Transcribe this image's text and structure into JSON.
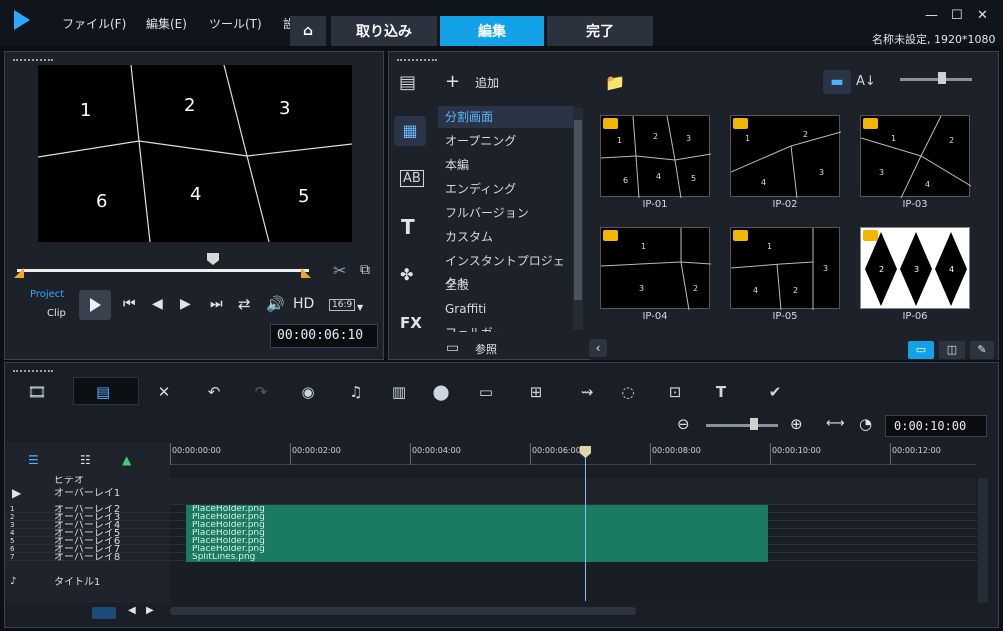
{
  "app": {
    "title": "名称未設定, 1920*1080"
  },
  "menu": [
    "ファイル(F)",
    "編集(E)",
    "ツール(T)",
    "設"
  ],
  "tabs": {
    "home": "⌂",
    "capture": "取り込み",
    "edit": "編集",
    "share": "完了"
  },
  "preview": {
    "split_numbers": [
      "1",
      "2",
      "3",
      "6",
      "4",
      "5"
    ],
    "mode_project": "Project",
    "mode_clip": "Clip",
    "hd": "HD",
    "aspect": "16:9",
    "timecode": "00:00:06:10"
  },
  "library": {
    "add_label": "追加",
    "browse_label": "参照",
    "categories": [
      "分割画面",
      "オープニング",
      "本編",
      "エンディング",
      "フルバージョン",
      "カスタム",
      "インスタントプロジェクト",
      "全般",
      "Graffiti",
      "フェルガー"
    ],
    "selected_category": 0,
    "thumbs": [
      "IP-01",
      "IP-02",
      "IP-03",
      "IP-04",
      "IP-05",
      "IP-06"
    ]
  },
  "timeline": {
    "zoom_timecode": "0:00:10:00",
    "ruler": [
      "00:00:00:00",
      "00:00:02:00",
      "00:00:04:00",
      "00:00:06:00",
      "00:00:08:00",
      "00:00:10:00",
      "00:00:12:00"
    ],
    "track_top_labels": [
      "ビデオ",
      "オーバーレイ1"
    ],
    "tracks": [
      {
        "label": "オーバーレイ2",
        "clip": "PlaceHolder.png"
      },
      {
        "label": "オーバーレイ3",
        "clip": "PlaceHolder.png"
      },
      {
        "label": "オーバーレイ4",
        "clip": "PlaceHolder.png"
      },
      {
        "label": "オーバーレイ5",
        "clip": "PlaceHolder.png"
      },
      {
        "label": "オーバーレイ6",
        "clip": "PlaceHolder.png"
      },
      {
        "label": "オーバーレイ7",
        "clip": "PlaceHolder.png"
      },
      {
        "label": "オーバーレイ8",
        "clip": "SplitLines.png"
      }
    ],
    "bottom_label": "タイトル1"
  },
  "colors": {
    "accent": "#13a2e8",
    "clip": "#1a7a62",
    "playhead": "#8fb4ff"
  }
}
